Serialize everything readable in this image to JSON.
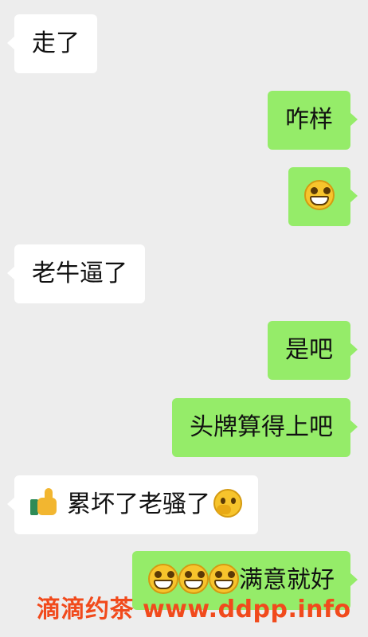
{
  "messages": [
    {
      "side": "in",
      "text": "走了"
    },
    {
      "side": "out",
      "text": "咋样"
    },
    {
      "side": "out",
      "emoji": "grin-icon"
    },
    {
      "side": "in",
      "text": "老牛逼了"
    },
    {
      "side": "out",
      "text": "是吧"
    },
    {
      "side": "out",
      "text": "头牌算得上吧"
    },
    {
      "side": "in",
      "prefix_emoji": "thumbs-up-icon",
      "text": "累坏了老骚了",
      "suffix_emoji": "thinking-face-icon"
    },
    {
      "side": "out",
      "emojis": [
        "grin-icon",
        "grin-icon",
        "grin-icon"
      ],
      "text": "满意就好"
    }
  ],
  "watermark": "滴滴约茶 www.ddpp.info",
  "colors": {
    "background": "#ededed",
    "incoming_bubble": "#ffffff",
    "outgoing_bubble": "#95ec69",
    "watermark": "#f14a1c"
  }
}
